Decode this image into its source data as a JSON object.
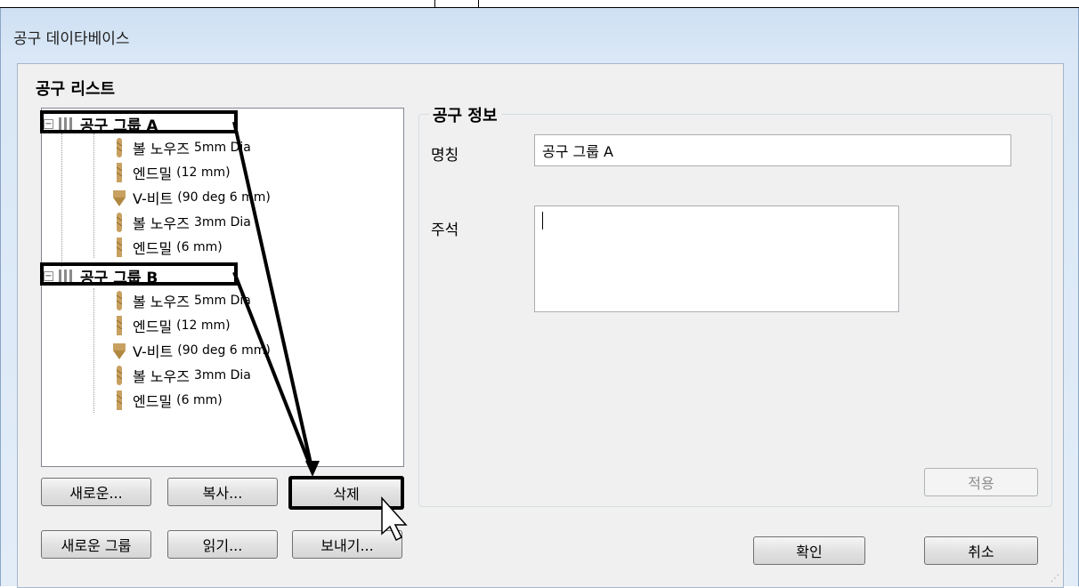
{
  "window": {
    "title": "공구 데이타베이스"
  },
  "tool_list": {
    "label": "공구 리스트",
    "groups": [
      {
        "name": "공구 그룹 A",
        "items": [
          {
            "name": "볼 노우즈",
            "dims": "5mm Dia",
            "icon": "ball-nose-drill-icon"
          },
          {
            "name": "엔드밀",
            "dims": "(12 mm)",
            "icon": "end-mill-icon"
          },
          {
            "name": "V-비트",
            "dims": "(90 deg 6 mm)",
            "icon": "v-bit-icon"
          },
          {
            "name": "볼 노우즈",
            "dims": "3mm Dia",
            "icon": "ball-nose-drill-icon"
          },
          {
            "name": "엔드밀",
            "dims": "(6 mm)",
            "icon": "end-mill-icon"
          }
        ]
      },
      {
        "name": "공구 그룹 B",
        "items": [
          {
            "name": "볼 노우즈",
            "dims": "5mm Dia",
            "icon": "ball-nose-drill-icon"
          },
          {
            "name": "엔드밀",
            "dims": "(12 mm)",
            "icon": "end-mill-icon"
          },
          {
            "name": "V-비트",
            "dims": "(90 deg 6 mm)",
            "icon": "v-bit-icon"
          },
          {
            "name": "볼 노우즈",
            "dims": "3mm Dia",
            "icon": "ball-nose-drill-icon"
          },
          {
            "name": "엔드밀",
            "dims": "(6 mm)",
            "icon": "end-mill-icon"
          }
        ]
      }
    ],
    "buttons": {
      "new": "새로운...",
      "copy": "복사...",
      "delete": "삭제",
      "new_group": "새로운 그룹",
      "read": "읽기...",
      "export": "보내기..."
    }
  },
  "tool_info": {
    "label": "공구 정보",
    "name_label": "명칭",
    "name_value": "공구 그룹 A",
    "notes_label": "주석",
    "notes_value": "",
    "apply": "적용"
  },
  "footer": {
    "ok": "확인",
    "cancel": "취소"
  },
  "colors": {
    "highlight_border": "#000000",
    "tool_gold": "#c8a060"
  }
}
